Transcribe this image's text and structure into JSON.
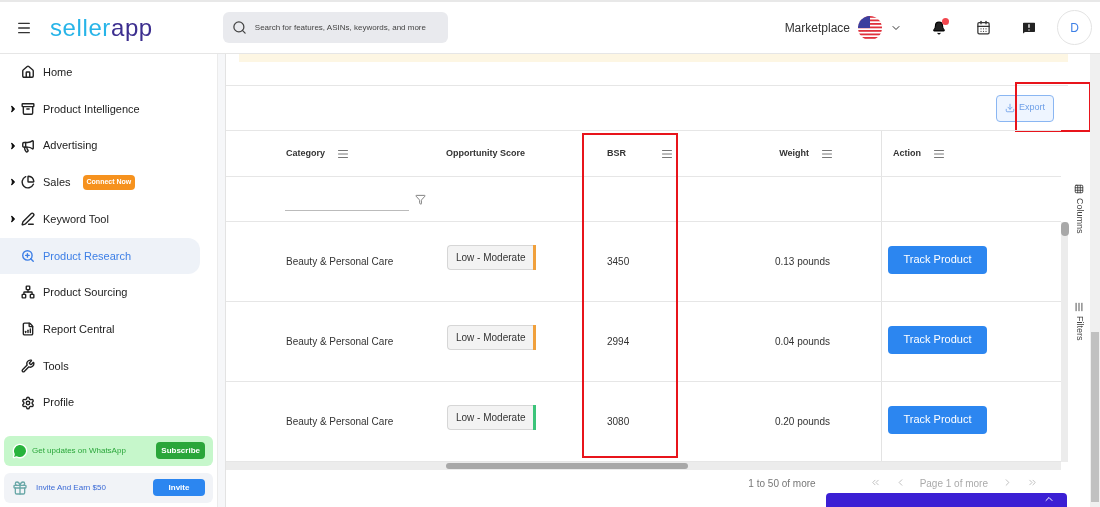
{
  "header": {
    "logo_start": "seller",
    "logo_end": "app",
    "search": {
      "placeholder": "Search for features, ASINs, keywords, and more"
    },
    "marketplace_label": "Marketplace",
    "notifications_unread": true,
    "avatar_initial": "D"
  },
  "sidebar": {
    "items": [
      {
        "label": "Home",
        "kind": "link",
        "selected": false
      },
      {
        "label": "Product Intelligence",
        "kind": "group",
        "selected": false
      },
      {
        "label": "Advertising",
        "kind": "group",
        "selected": false
      },
      {
        "label": "Sales",
        "kind": "group",
        "selected": false,
        "badge": "Connect Now"
      },
      {
        "label": "Keyword Tool",
        "kind": "group",
        "selected": false
      },
      {
        "label": "Product Research",
        "kind": "link",
        "selected": true
      },
      {
        "label": "Product Sourcing",
        "kind": "link",
        "selected": false
      },
      {
        "label": "Report Central",
        "kind": "link",
        "selected": false
      },
      {
        "label": "Tools",
        "kind": "link",
        "selected": false
      },
      {
        "label": "Profile",
        "kind": "link",
        "selected": false
      }
    ],
    "promos": [
      {
        "kind": "whatsapp",
        "text": "Get updates on WhatsApp",
        "button": "Subscribe"
      },
      {
        "kind": "invite",
        "text": "Invite And Earn $50",
        "button": "Invite"
      }
    ]
  },
  "toolbar": {
    "export_label": "Export",
    "highlighted": true
  },
  "table": {
    "columns": [
      {
        "label": "Category",
        "menu": true,
        "highlighted": false
      },
      {
        "label": "Opportunity Score",
        "menu": false,
        "highlighted": false
      },
      {
        "label": "BSR",
        "menu": true,
        "highlighted": true
      },
      {
        "label": "Weight",
        "menu": true,
        "highlighted": false
      },
      {
        "label": "Action",
        "menu": true,
        "highlighted": false
      }
    ],
    "rows": [
      {
        "category": "Beauty & Personal Care",
        "score": "Low - Moderate",
        "color": "#f0a03c",
        "bsr": "3450",
        "weight": "0.13 pounds",
        "action": "Track Product"
      },
      {
        "category": "Beauty & Personal Care",
        "score": "Low - Moderate",
        "color": "#f0a03c",
        "bsr": "2994",
        "weight": "0.04 pounds",
        "action": "Track Product"
      },
      {
        "category": "Beauty & Personal Care",
        "score": "Low - Moderate",
        "color": "#3cc47a",
        "bsr": "3080",
        "weight": "0.20 pounds",
        "action": "Track Product"
      }
    ]
  },
  "side_tabs": [
    "Columns",
    "Filters"
  ],
  "pagination": {
    "summary": "1 to 50 of more",
    "page": "Page 1 of more"
  }
}
